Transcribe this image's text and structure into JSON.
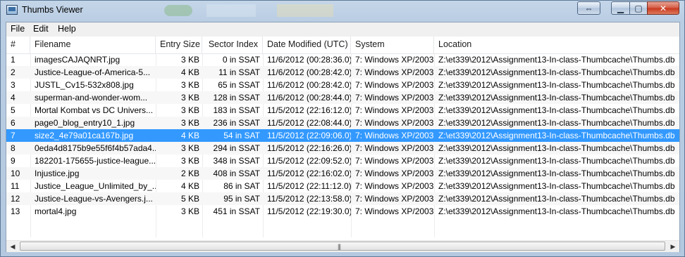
{
  "window": {
    "title": "Thumbs Viewer"
  },
  "menu": [
    {
      "label": "File"
    },
    {
      "label": "Edit"
    },
    {
      "label": "Help"
    }
  ],
  "columns": [
    "#",
    "Filename",
    "Entry Size",
    "Sector Index",
    "Date Modified (UTC)",
    "System",
    "Location"
  ],
  "rows": [
    {
      "num": "1",
      "filename": "imagesCAJAQNRT.jpg",
      "size": "3 KB",
      "sector": "0 in SSAT",
      "date": "11/6/2012 (00:28:36.0)",
      "system": "7: Windows XP/2003",
      "location": "Z:\\et339\\2012\\Assignment13-In-class-Thumbcache\\Thumbs.db"
    },
    {
      "num": "2",
      "filename": "Justice-League-of-America-5...",
      "size": "4 KB",
      "sector": "11 in SSAT",
      "date": "11/6/2012 (00:28:42.0)",
      "system": "7: Windows XP/2003",
      "location": "Z:\\et339\\2012\\Assignment13-In-class-Thumbcache\\Thumbs.db"
    },
    {
      "num": "3",
      "filename": "JUSTL_Cv15-532x808.jpg",
      "size": "3 KB",
      "sector": "65 in SSAT",
      "date": "11/6/2012 (00:28:42.0)",
      "system": "7: Windows XP/2003",
      "location": "Z:\\et339\\2012\\Assignment13-In-class-Thumbcache\\Thumbs.db"
    },
    {
      "num": "4",
      "filename": "superman-and-wonder-wom...",
      "size": "3 KB",
      "sector": "128 in SSAT",
      "date": "11/6/2012 (00:28:44.0)",
      "system": "7: Windows XP/2003",
      "location": "Z:\\et339\\2012\\Assignment13-In-class-Thumbcache\\Thumbs.db"
    },
    {
      "num": "5",
      "filename": "Mortal Kombat vs DC Univers...",
      "size": "3 KB",
      "sector": "183 in SSAT",
      "date": "11/5/2012 (22:16:12.0)",
      "system": "7: Windows XP/2003",
      "location": "Z:\\et339\\2012\\Assignment13-In-class-Thumbcache\\Thumbs.db"
    },
    {
      "num": "6",
      "filename": "page0_blog_entry10_1.jpg",
      "size": "3 KB",
      "sector": "236 in SSAT",
      "date": "11/5/2012 (22:08:44.0)",
      "system": "7: Windows XP/2003",
      "location": "Z:\\et339\\2012\\Assignment13-In-class-Thumbcache\\Thumbs.db"
    },
    {
      "num": "7",
      "filename": "size2_4e79a01ca167b.jpg",
      "size": "4 KB",
      "sector": "54 in SAT",
      "date": "11/5/2012 (22:09:06.0)",
      "system": "7: Windows XP/2003",
      "location": "Z:\\et339\\2012\\Assignment13-In-class-Thumbcache\\Thumbs.db",
      "selected": true
    },
    {
      "num": "8",
      "filename": "0eda4d8175b9e55f6f4b57ada4...",
      "size": "3 KB",
      "sector": "294 in SSAT",
      "date": "11/5/2012 (22:16:26.0)",
      "system": "7: Windows XP/2003",
      "location": "Z:\\et339\\2012\\Assignment13-In-class-Thumbcache\\Thumbs.db"
    },
    {
      "num": "9",
      "filename": "182201-175655-justice-league...",
      "size": "3 KB",
      "sector": "348 in SSAT",
      "date": "11/5/2012 (22:09:52.0)",
      "system": "7: Windows XP/2003",
      "location": "Z:\\et339\\2012\\Assignment13-In-class-Thumbcache\\Thumbs.db"
    },
    {
      "num": "10",
      "filename": "Injustice.jpg",
      "size": "2 KB",
      "sector": "408 in SSAT",
      "date": "11/5/2012 (22:16:02.0)",
      "system": "7: Windows XP/2003",
      "location": "Z:\\et339\\2012\\Assignment13-In-class-Thumbcache\\Thumbs.db"
    },
    {
      "num": "11",
      "filename": "Justice_League_Unlimited_by_...",
      "size": "4 KB",
      "sector": "86 in SAT",
      "date": "11/5/2012 (22:11:12.0)",
      "system": "7: Windows XP/2003",
      "location": "Z:\\et339\\2012\\Assignment13-In-class-Thumbcache\\Thumbs.db"
    },
    {
      "num": "12",
      "filename": "Justice-League-vs-Avengers.j...",
      "size": "5 KB",
      "sector": "95 in SAT",
      "date": "11/5/2012 (22:13:58.0)",
      "system": "7: Windows XP/2003",
      "location": "Z:\\et339\\2012\\Assignment13-In-class-Thumbcache\\Thumbs.db"
    },
    {
      "num": "13",
      "filename": "mortal4.jpg",
      "size": "3 KB",
      "sector": "451 in SSAT",
      "date": "11/5/2012 (22:19:30.0)",
      "system": "7: Windows XP/2003",
      "location": "Z:\\et339\\2012\\Assignment13-In-class-Thumbcache\\Thumbs.db"
    }
  ],
  "icons": {
    "app": "thumbs-viewer-app-icon",
    "resize": "resize-arrows-icon",
    "minimize": "minimize-icon",
    "maximize": "maximize-icon",
    "close": "close-icon",
    "scroll_left": "scroll-left-arrow-icon",
    "scroll_right": "scroll-right-arrow-icon",
    "scroll_grip": "scroll-grip-icon"
  },
  "colors": {
    "selection": "#3399ff",
    "close_button": "#c7371f"
  }
}
